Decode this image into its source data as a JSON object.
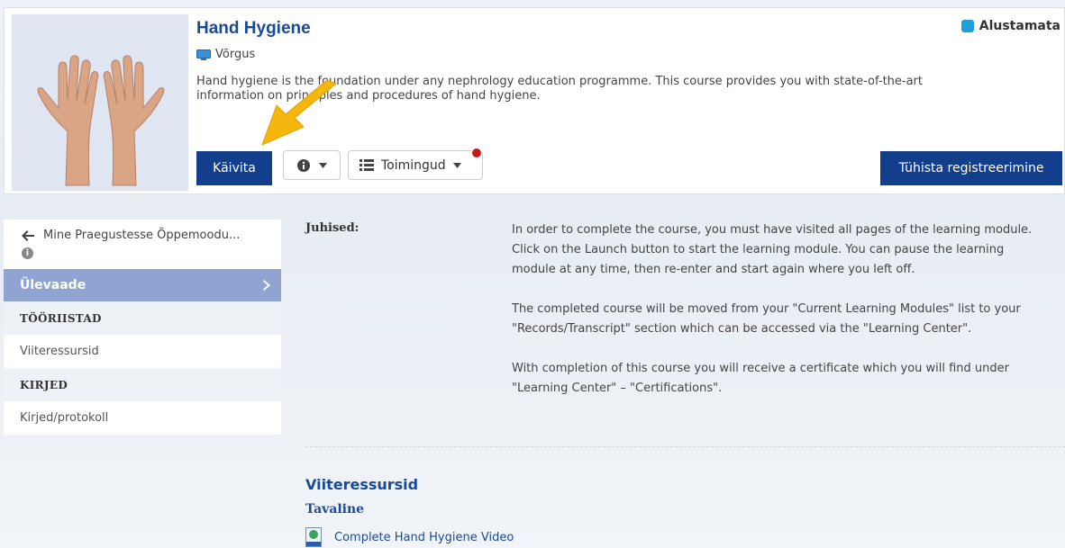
{
  "course": {
    "title": "Hand Hygiene",
    "delivery_type": "Võrgus",
    "description": "Hand hygiene is the foundation under any nephrology education programme. This course provides you with state-of-the-art information on principles and procedures of hand hygiene.",
    "status": "Alustamata",
    "status_color": "#1fa0d8"
  },
  "actions": {
    "launch_label": "Käivita",
    "options_label": "Toimingud",
    "unregister_label": "Tühista registreerimine"
  },
  "sidebar": {
    "back_label": "Mine Praegustesse Õppemoodu...",
    "active_label": "Ülevaade",
    "sections": [
      {
        "title": "TÖÖRIISTAD",
        "items": [
          "Viiteressursid"
        ]
      },
      {
        "title": "KIRJED",
        "items": [
          "Kirjed/protokoll"
        ]
      }
    ]
  },
  "instructions": {
    "label": "Juhised:",
    "paragraphs": [
      "In order to complete the course, you must have visited all pages of the learning module. Click on the Launch button to start the learning module. You can pause the learning module at any time, then re-enter and start again where you left off.",
      "The completed course will be moved from your \"Current Learning Modules\" list to your \"Records/Transcript\" section which can be accessed via the \"Learning Center\".",
      "With completion of this course you will receive a certificate which you will find under \"Learning Center\" – \"Certifications\"."
    ]
  },
  "references": {
    "title": "Viiteressursid",
    "subtitle": "Tavaline",
    "link": "Complete Hand Hygiene Video"
  },
  "colors": {
    "primary": "#123e8b",
    "title_blue": "#1a4a94",
    "sidebar_active": "#8fa4d0",
    "notification": "#c41a1a"
  }
}
